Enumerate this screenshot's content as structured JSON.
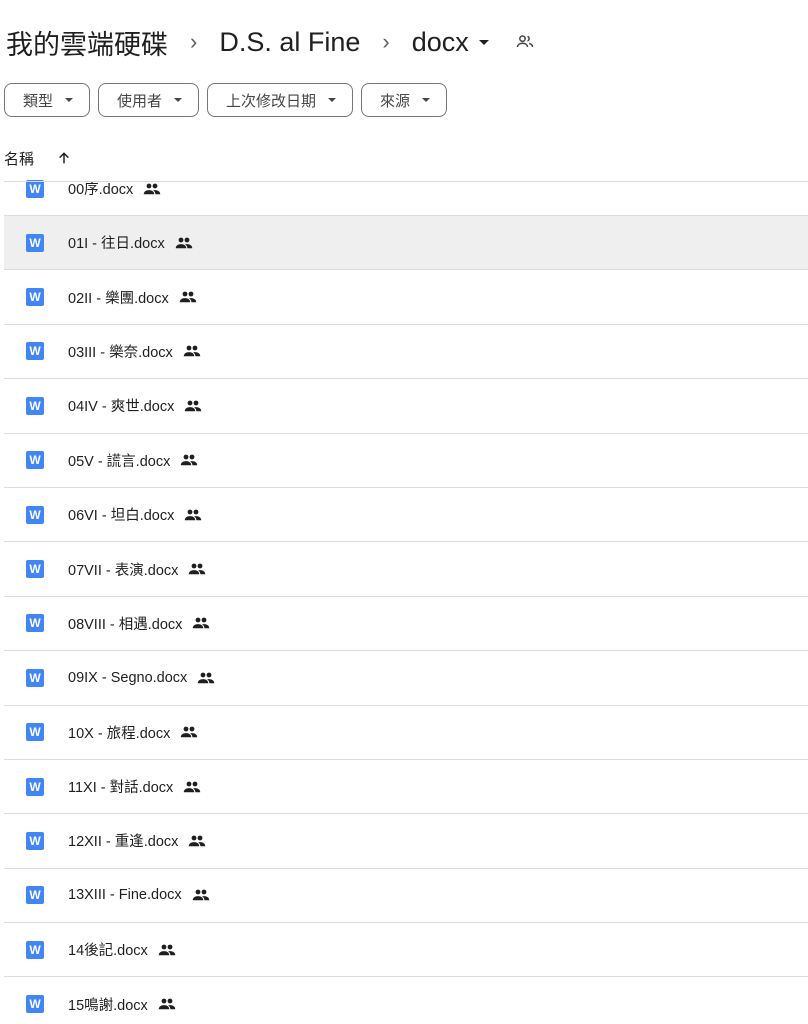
{
  "breadcrumb": {
    "root": "我的雲端硬碟",
    "parent": "D.S. al Fine",
    "current": "docx",
    "separator": "›"
  },
  "filters": [
    {
      "label": "類型"
    },
    {
      "label": "使用者"
    },
    {
      "label": "上次修改日期"
    },
    {
      "label": "來源"
    }
  ],
  "list_header": {
    "name_column": "名稱"
  },
  "file_icon_letter": "W",
  "files": [
    {
      "name": "00序.docx"
    },
    {
      "name": "01I - 往日.docx"
    },
    {
      "name": "02II - 樂團.docx"
    },
    {
      "name": "03III - 樂奈.docx"
    },
    {
      "name": "04IV - 爽世.docx"
    },
    {
      "name": "05V - 謊言.docx"
    },
    {
      "name": "06VI - 坦白.docx"
    },
    {
      "name": "07VII - 表演.docx"
    },
    {
      "name": "08VIII - 相遇.docx"
    },
    {
      "name": "09IX - Segno.docx"
    },
    {
      "name": "10X - 旅程.docx"
    },
    {
      "name": "11XI - 對話.docx"
    },
    {
      "name": "12XII - 重逢.docx"
    },
    {
      "name": "13XIII - Fine.docx"
    },
    {
      "name": "14後記.docx"
    },
    {
      "name": "15鳴謝.docx"
    }
  ],
  "colors": {
    "word_blue": "#4285f4",
    "selected_row": "#efefef",
    "divider": "#dadce0"
  }
}
